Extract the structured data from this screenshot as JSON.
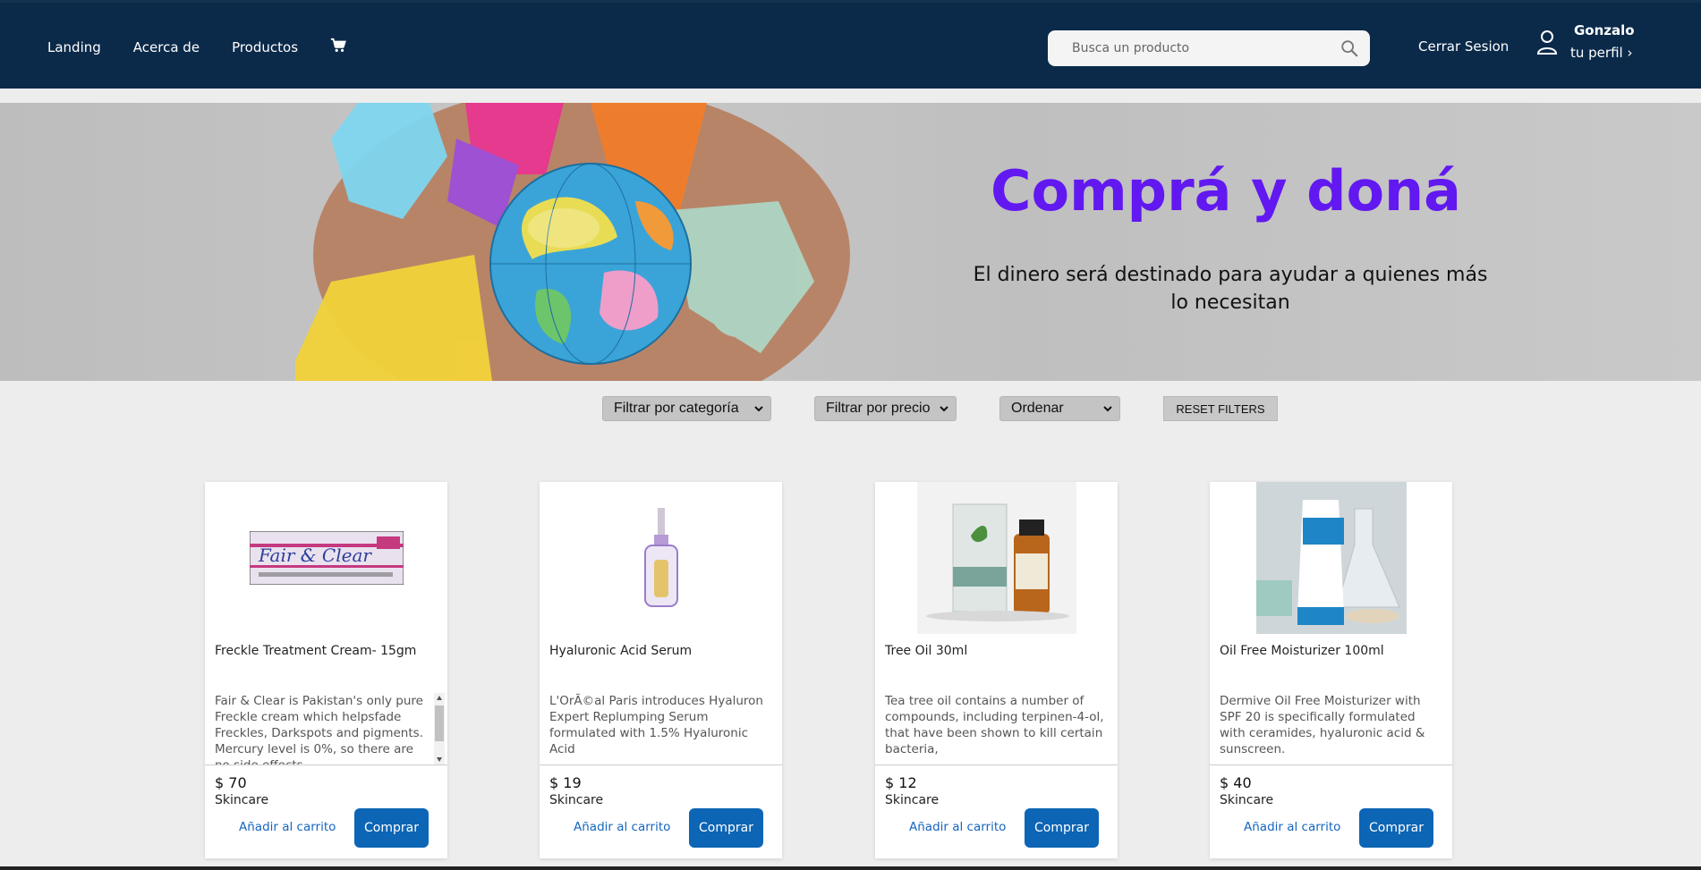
{
  "nav": {
    "links": [
      "Landing",
      "Acerca de",
      "Productos"
    ],
    "search_placeholder": "Busca un producto",
    "logout": "Cerrar Sesion",
    "user_name": "Gonzalo",
    "profile_link": "tu perfil ›"
  },
  "hero": {
    "title": "Comprá y doná",
    "subtitle": "El dinero será destinado para ayudar a quienes más lo necesitan"
  },
  "filters": {
    "category": "Filtrar por categoría",
    "price": "Filtrar por precio",
    "order": "Ordenar",
    "reset": "RESET FILTERS"
  },
  "products": [
    {
      "title": "Freckle Treatment Cream- 15gm",
      "description": "Fair & Clear is Pakistan's only pure Freckle cream which helpsfade Freckles, Darkspots and pigments. Mercury level is 0%, so there are no side effects",
      "price": "$ 70",
      "category": "Skincare",
      "add_label": "Añadir al carrito",
      "buy_label": "Comprar",
      "image_text": "Fair & Clear"
    },
    {
      "title": "Hyaluronic Acid Serum",
      "description": "L'OrÃ©al Paris introduces Hyaluron Expert Replumping Serum formulated with 1.5% Hyaluronic Acid",
      "price": "$ 19",
      "category": "Skincare",
      "add_label": "Añadir al carrito",
      "buy_label": "Comprar"
    },
    {
      "title": "Tree Oil 30ml",
      "description": "Tea tree oil contains a number of compounds, including terpinen-4-ol, that have been shown to kill certain bacteria,",
      "price": "$ 12",
      "category": "Skincare",
      "add_label": "Añadir al carrito",
      "buy_label": "Comprar"
    },
    {
      "title": "Oil Free Moisturizer 100ml",
      "description": "Dermive Oil Free Moisturizer with SPF 20 is specifically formulated with ceramides, hyaluronic acid & sunscreen.",
      "price": "$ 40",
      "category": "Skincare",
      "add_label": "Añadir al carrito",
      "buy_label": "Comprar"
    }
  ],
  "colors": {
    "navbar": "#0b2a4a",
    "hero_title": "#6218f0",
    "buy_button": "#0d65b5",
    "link": "#1565c0"
  }
}
